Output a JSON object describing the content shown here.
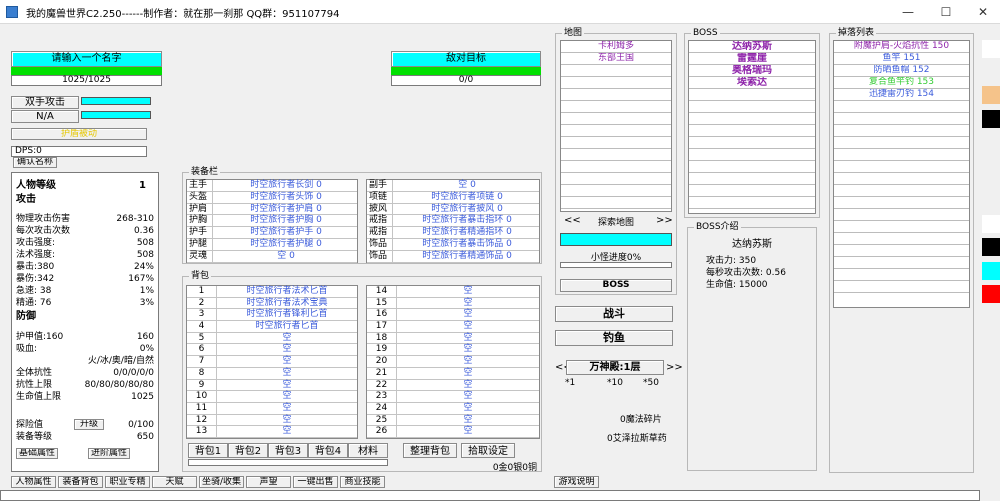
{
  "window": {
    "title": "我的魔兽世界C2.250------制作者：就在那一刹那 QQ群：951107794",
    "min": "—",
    "max": "☐",
    "close": "✕"
  },
  "player": {
    "name_btn": "请输入一个名字",
    "hp": "1025/1025"
  },
  "enemy": {
    "name_btn": "敌对目标",
    "hp": "0/0"
  },
  "left": {
    "dual_attack": "双手攻击",
    "na": "N/A",
    "plain": "护盾被动",
    "dps": "DPS:0",
    "confirm_name": "确认名称",
    "level_label": "人物等级",
    "level_value": "1",
    "attack_title": "攻击",
    "attack_stats": [
      {
        "k": "物理攻击伤害",
        "v": "268-310"
      },
      {
        "k": "每次攻击次数",
        "v": "0.36"
      },
      {
        "k": "攻击强度:",
        "v": "508"
      },
      {
        "k": "法术强度:",
        "v": "508"
      },
      {
        "k": "暴击:380",
        "v": "24%"
      },
      {
        "k": "暴伤:342",
        "v": "167%"
      },
      {
        "k": "急速: 38",
        "v": "1%"
      },
      {
        "k": "精通: 76",
        "v": "3%"
      }
    ],
    "defense_title": "防御",
    "defense_stats": [
      {
        "k": "护甲值:160",
        "v": "160"
      },
      {
        "k": "吸血:",
        "v": "0%"
      },
      {
        "k": "",
        "v": "火/冰/奥/暗/自然"
      },
      {
        "k": "全体抗性",
        "v": "0/0/0/0/0"
      },
      {
        "k": "抗性上限",
        "v": "80/80/80/80/80"
      },
      {
        "k": "生命值上限",
        "v": "1025"
      }
    ],
    "explore_label": "探险值",
    "upgrade_btn": "升级",
    "explore_value": "0/100",
    "equip_level_label": "装备等级",
    "equip_level_value": "650",
    "base_attr_btn": "基础属性",
    "adv_attr_btn": "进阶属性"
  },
  "equipment": {
    "title": "装备栏",
    "left": [
      {
        "k": "主手",
        "v": "时空旅行者长剑 0"
      },
      {
        "k": "头盔",
        "v": "时空旅行者头饰 0"
      },
      {
        "k": "护肩",
        "v": "时空旅行者护肩 0"
      },
      {
        "k": "护胸",
        "v": "时空旅行者护胸 0"
      },
      {
        "k": "护手",
        "v": "时空旅行者护手 0"
      },
      {
        "k": "护腿",
        "v": "时空旅行者护腿 0"
      },
      {
        "k": "灵魂",
        "v": "空 0"
      }
    ],
    "right": [
      {
        "k": "副手",
        "v": "空 0"
      },
      {
        "k": "项链",
        "v": "时空旅行者项链 0"
      },
      {
        "k": "披风",
        "v": "时空旅行者披风 0"
      },
      {
        "k": "戒指",
        "v": "时空旅行者暴击指环 0"
      },
      {
        "k": "戒指",
        "v": "时空旅行者精通指环 0"
      },
      {
        "k": "饰品",
        "v": "时空旅行者暴击饰品 0"
      },
      {
        "k": "饰品",
        "v": "时空旅行者精通饰品 0"
      }
    ]
  },
  "backpack": {
    "title": "背包",
    "left": [
      {
        "n": "1",
        "v": "时空旅行者法术匕首"
      },
      {
        "n": "2",
        "v": "时空旅行者法术宝典"
      },
      {
        "n": "3",
        "v": "时空旅行者锋利匕首"
      },
      {
        "n": "4",
        "v": "时空旅行者匕首"
      },
      {
        "n": "5",
        "v": "空"
      },
      {
        "n": "6",
        "v": "空"
      },
      {
        "n": "7",
        "v": "空"
      },
      {
        "n": "8",
        "v": "空"
      },
      {
        "n": "9",
        "v": "空"
      },
      {
        "n": "10",
        "v": "空"
      },
      {
        "n": "11",
        "v": "空"
      },
      {
        "n": "12",
        "v": "空"
      },
      {
        "n": "13",
        "v": "空"
      }
    ],
    "right": [
      {
        "n": "14",
        "v": "空"
      },
      {
        "n": "15",
        "v": "空"
      },
      {
        "n": "16",
        "v": "空"
      },
      {
        "n": "17",
        "v": "空"
      },
      {
        "n": "18",
        "v": "空"
      },
      {
        "n": "19",
        "v": "空"
      },
      {
        "n": "20",
        "v": "空"
      },
      {
        "n": "21",
        "v": "空"
      },
      {
        "n": "22",
        "v": "空"
      },
      {
        "n": "23",
        "v": "空"
      },
      {
        "n": "24",
        "v": "空"
      },
      {
        "n": "25",
        "v": "空"
      },
      {
        "n": "26",
        "v": "空"
      }
    ],
    "tabs": [
      "背包1",
      "背包2",
      "背包3",
      "背包4",
      "材料"
    ],
    "sort_btn": "整理背包",
    "settings_btn": "拾取设定",
    "money": "0金0银0铜"
  },
  "map": {
    "title": "地图",
    "items": [
      "卡利姆多",
      "东部王国"
    ],
    "prev": "<<",
    "explore_btn": "探索地图",
    "next": ">>",
    "progress_label": "小怪进度0%",
    "boss_btn": "BOSS"
  },
  "actions": {
    "fight": "战斗",
    "fish": "钓鱼",
    "dungeon_prev": "<<",
    "dungeon": "万神殿:1层",
    "dungeon_next": ">>",
    "mult1": "*1",
    "mult10": "*10",
    "mult50": "*50",
    "magic_shards": "0魔法碎片",
    "herbs": "0艾泽拉斯草药"
  },
  "boss": {
    "title": "BOSS",
    "list": [
      "达纳苏斯",
      "雷霆崖",
      "奥格瑞玛",
      "埃索达"
    ],
    "intro_title": "BOSS介绍",
    "intro_name": "达纳苏斯",
    "attack": "攻击力: 350",
    "attacks_per_sec": "每秒攻击次数: 0.56",
    "hp": "生命值: 15000"
  },
  "drops": {
    "title": "掉落列表",
    "items": [
      {
        "t": "附魔护肩-火焰抗性 150",
        "c": "#8e24aa"
      },
      {
        "t": "鱼竿 151",
        "c": "#3b5bdb"
      },
      {
        "t": "防晒鱼帽 152",
        "c": "#3b5bdb"
      },
      {
        "t": "复合鱼竿钓 153",
        "c": "#33cc33"
      },
      {
        "t": "迅捷雷刃钓 154",
        "c": "#3b5bdb"
      }
    ]
  },
  "swatches": [
    "#ffffff",
    "#f5c38a",
    "#000000",
    "#ffffff",
    "#000000",
    "#00ffff",
    "#ff0000"
  ],
  "bottom_tabs": [
    "人物属性",
    "装备背包",
    "职业专精",
    "天赋",
    "坐骑/收集",
    "声望",
    "一键出售",
    "商业技能"
  ],
  "help": "游戏说明"
}
